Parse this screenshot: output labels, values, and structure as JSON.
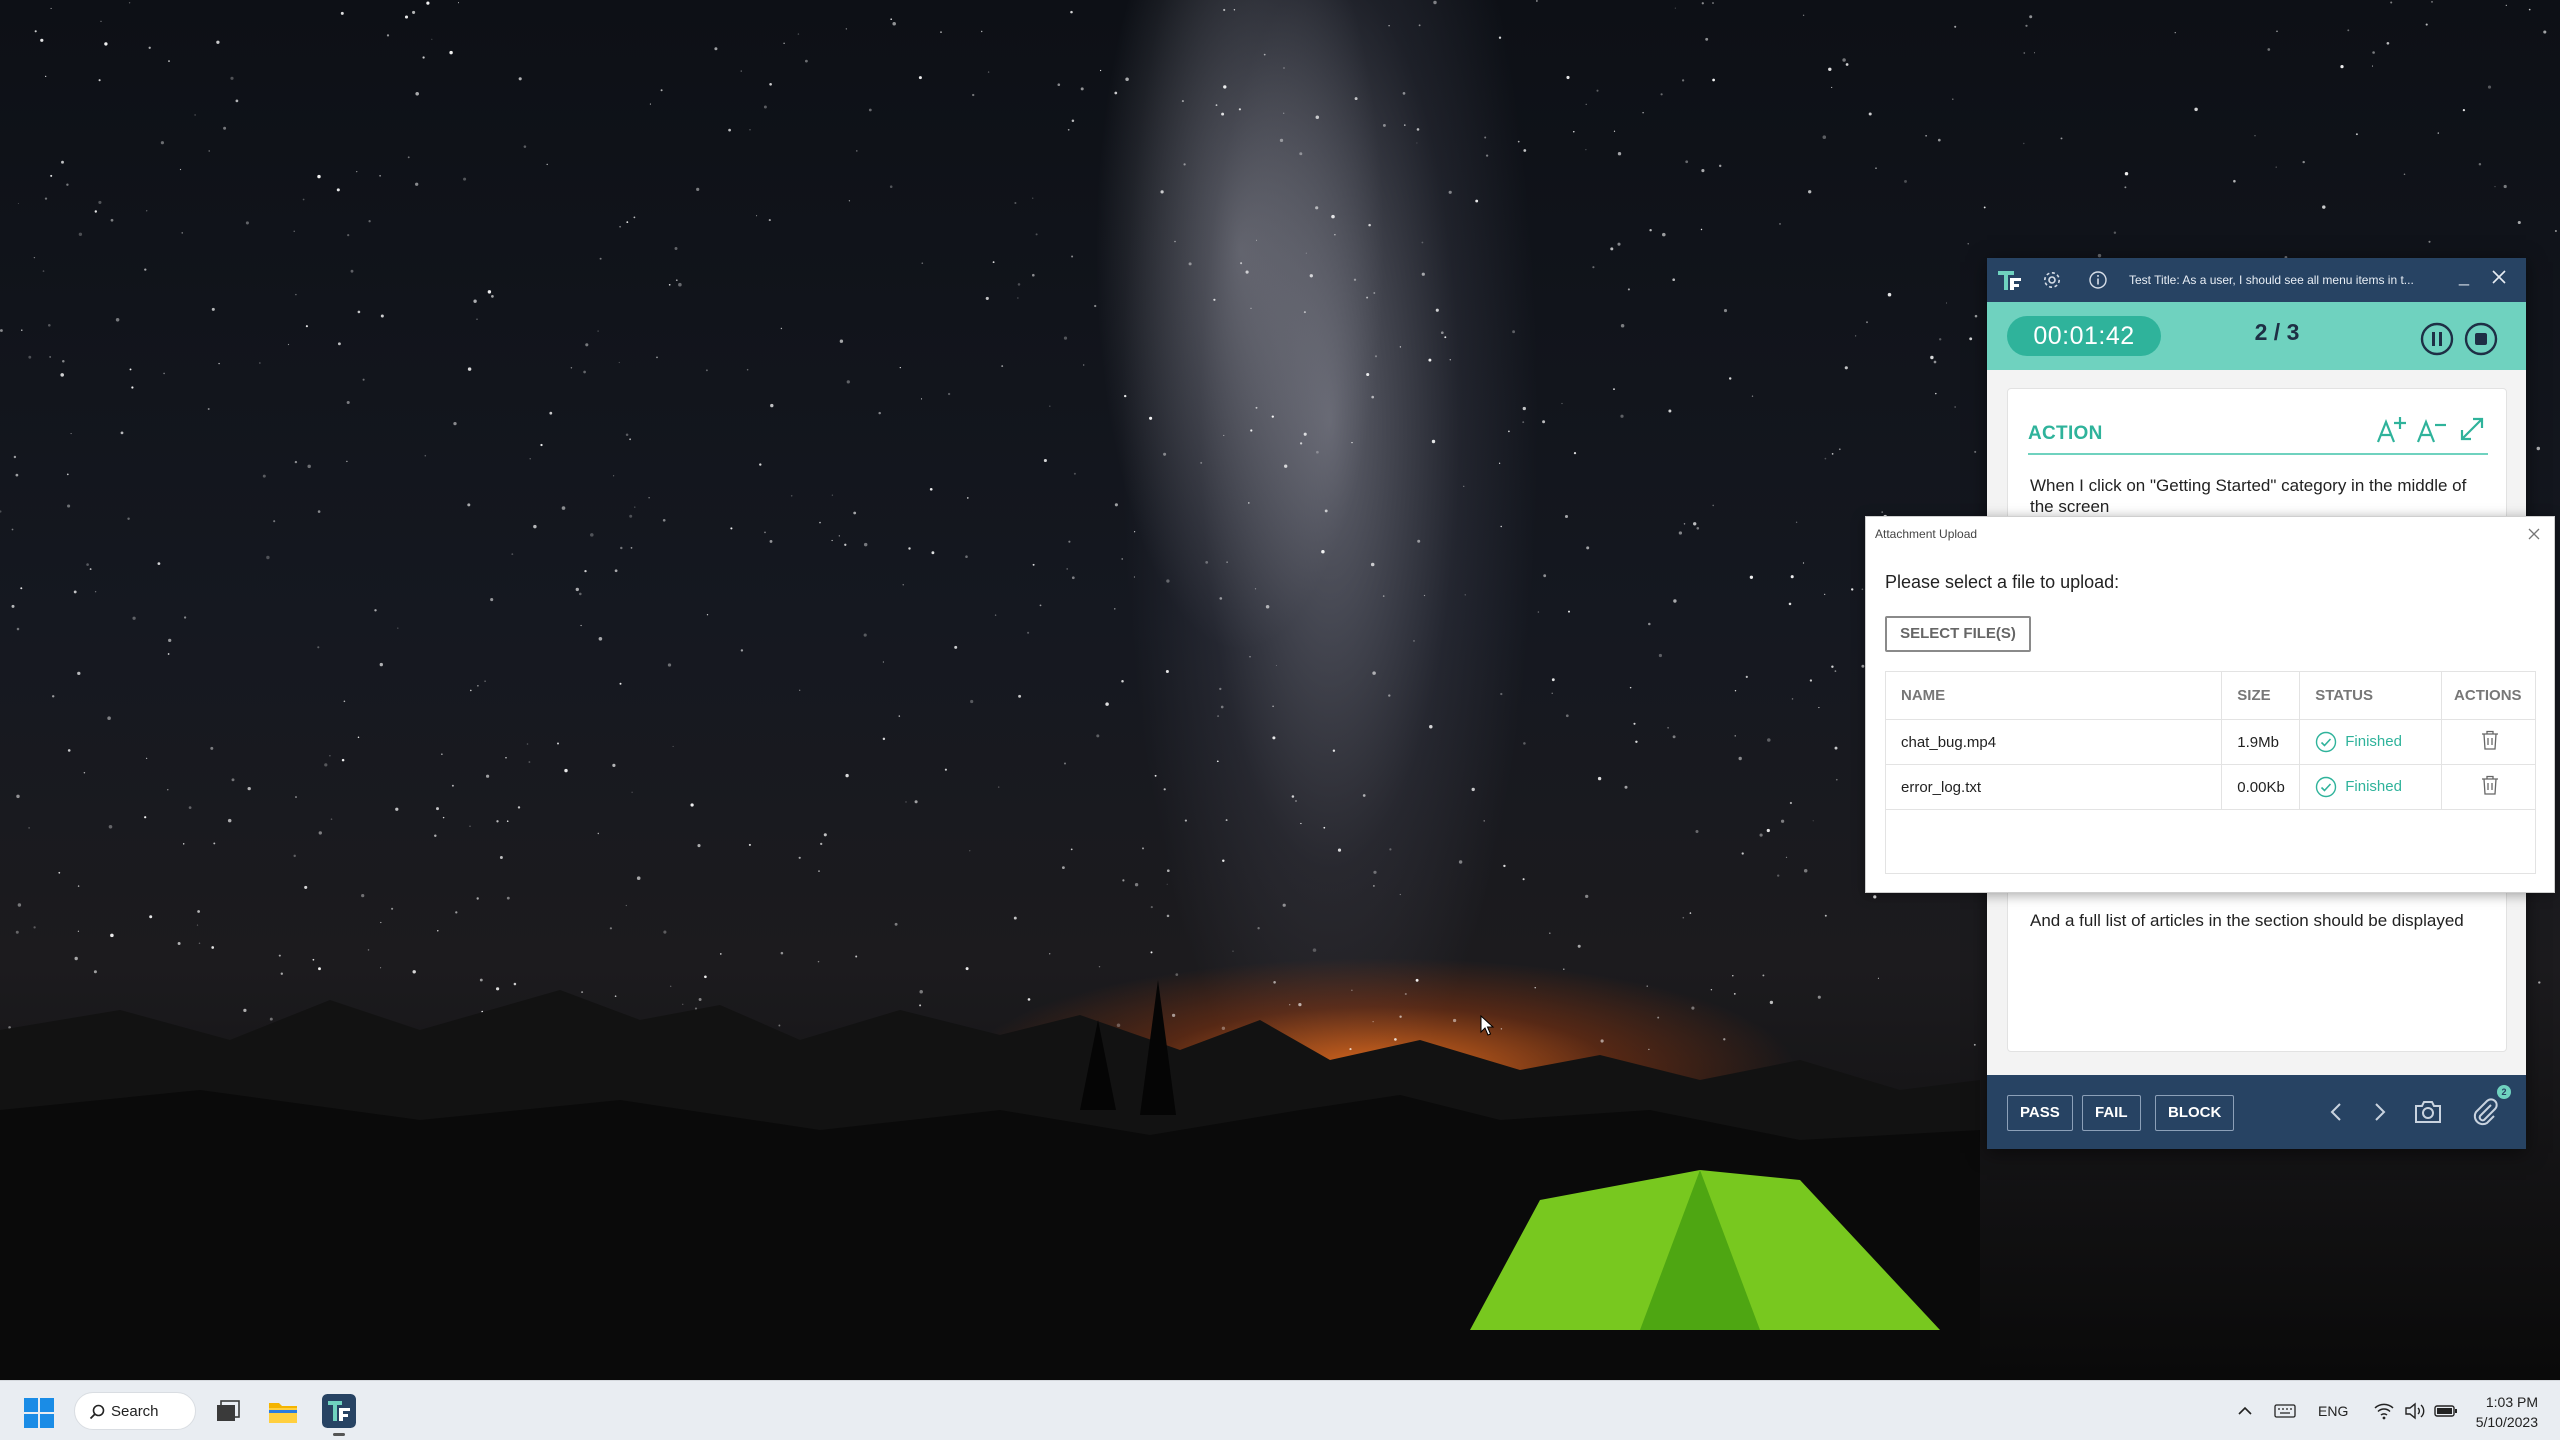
{
  "runner": {
    "title": "Test Title: As a user, I should see all menu items in t...",
    "timer": "00:01:42",
    "step": "2 / 3",
    "action_label": "ACTION",
    "action_text": "When I click on \"Getting Started\" category in the middle of the screen",
    "expected_text": "And a full list of articles in the section should be displayed",
    "buttons": {
      "pass": "PASS",
      "fail": "FAIL",
      "block": "BLOCK"
    },
    "attachment_count": "2",
    "colors": {
      "navy": "#274363",
      "teal": "#6fd2bf",
      "teal_dark": "#2fb39b"
    }
  },
  "dialog": {
    "title": "Attachment Upload",
    "prompt": "Please select a file to upload:",
    "select_button": "SELECT FILE(S)",
    "columns": [
      "NAME",
      "SIZE",
      "STATUS",
      "ACTIONS"
    ],
    "files": [
      {
        "name": "chat_bug.mp4",
        "size": "1.9Mb",
        "status": "Finished"
      },
      {
        "name": "error_log.txt",
        "size": "0.00Kb",
        "status": "Finished"
      }
    ]
  },
  "taskbar": {
    "search": "Search",
    "language": "ENG",
    "time": "1:03 PM",
    "date": "5/10/2023"
  }
}
